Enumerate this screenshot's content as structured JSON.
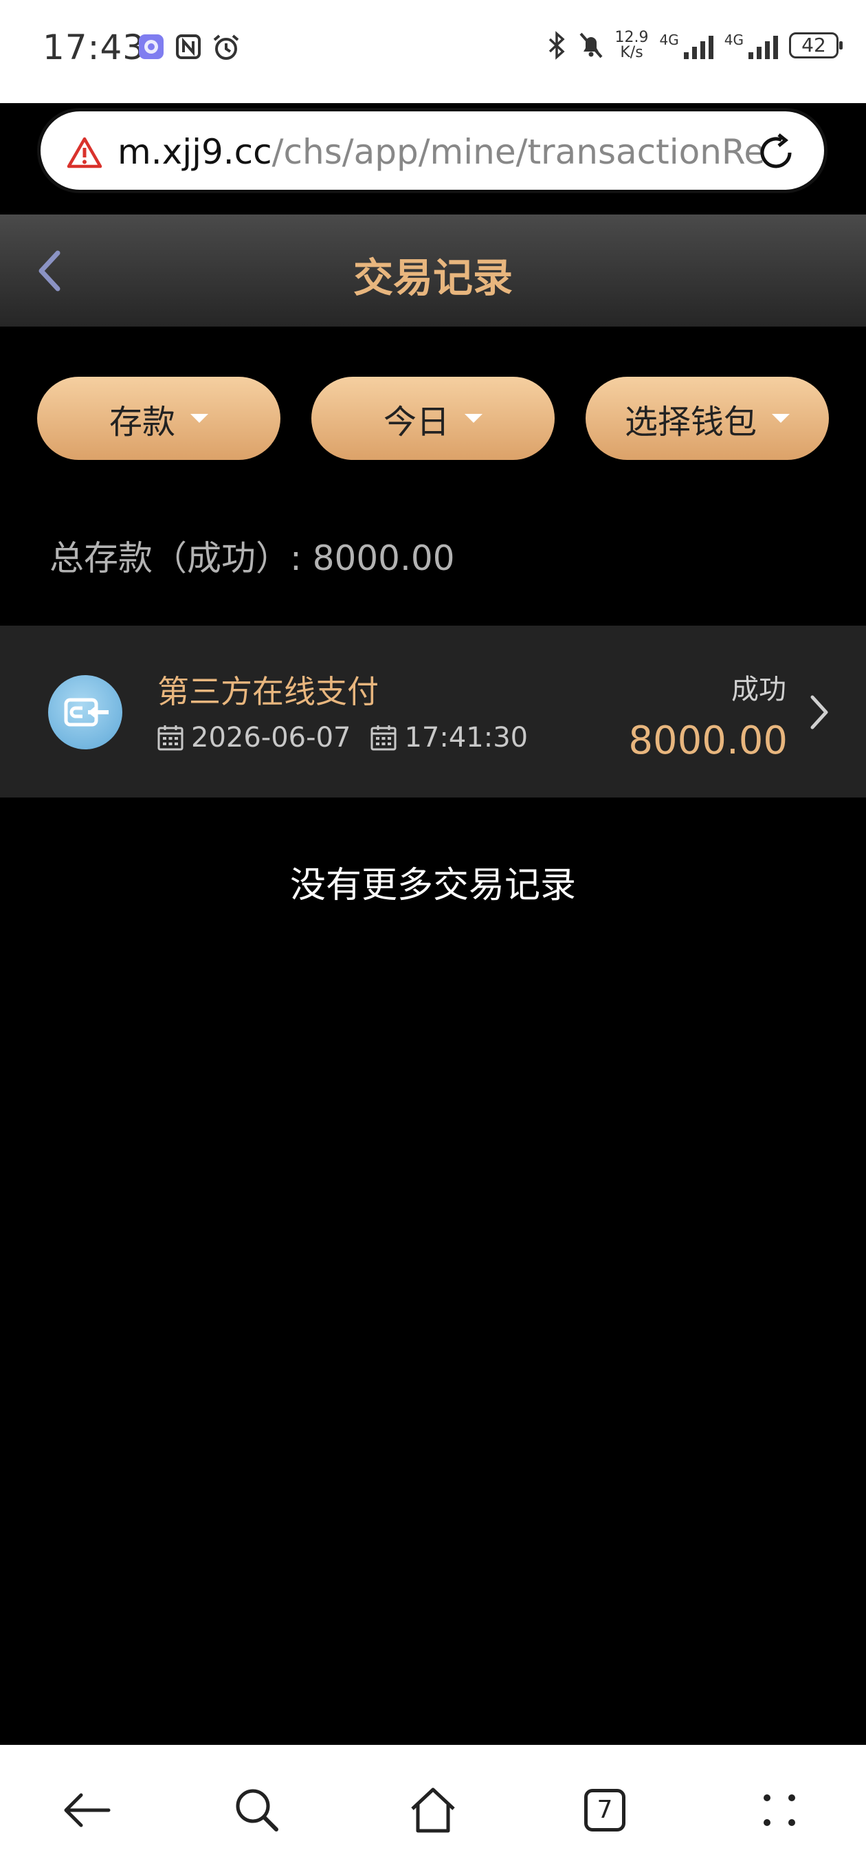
{
  "status_bar": {
    "time": "17:43",
    "net_speed_value": "12.9",
    "net_speed_unit": "K/s",
    "sim1_label": "4G",
    "sim2_label": "4G",
    "battery": "42"
  },
  "browser": {
    "url_host": "m.xjj9.cc",
    "url_path": "/chs/app/mine/transactionRe"
  },
  "header": {
    "title": "交易记录"
  },
  "filters": {
    "type_label": "存款",
    "date_label": "今日",
    "wallet_label": "选择钱包"
  },
  "summary": {
    "text": "总存款（成功）: 8000.00"
  },
  "transactions": [
    {
      "name": "第三方在线支付",
      "date": "2026-06-07",
      "time": "17:41:30",
      "status": "成功",
      "amount": "8000.00"
    }
  ],
  "list_end_text": "没有更多交易记录",
  "bottom_nav": {
    "tab_count": "7"
  },
  "colors": {
    "accent_gold": "#e8b67e",
    "button_gradient_top": "#f5cfa0",
    "button_gradient_bottom": "#dca269",
    "row_background": "#232323"
  },
  "icons": {
    "back": "chevron-left-icon",
    "warning": "warning-triangle-icon",
    "reload": "reload-icon",
    "calendar": "calendar-icon",
    "row_arrow": "chevron-right-icon",
    "payment": "wallet-transfer-icon"
  }
}
